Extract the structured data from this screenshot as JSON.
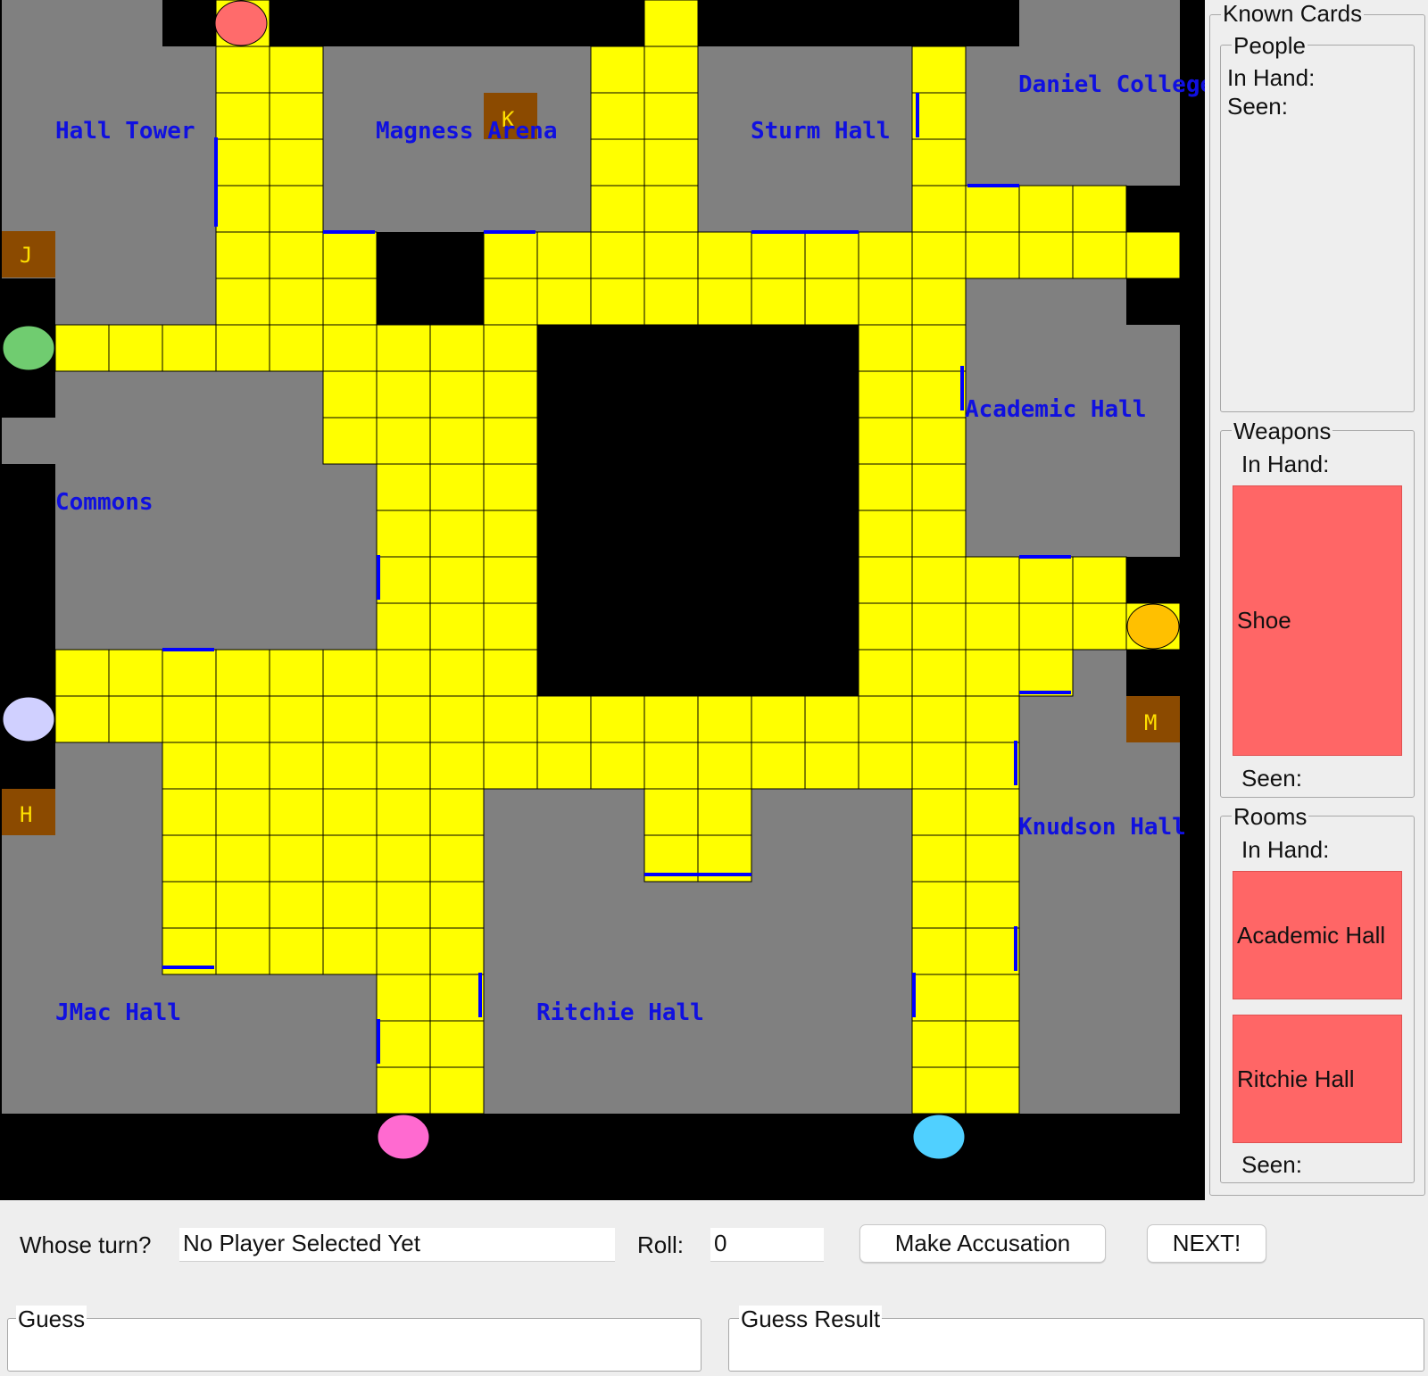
{
  "board": {
    "rooms": [
      {
        "name": "Hall Tower"
      },
      {
        "name": "Magness Arena"
      },
      {
        "name": "Sturm Hall"
      },
      {
        "name": "Daniel College"
      },
      {
        "name": "Academic Hall"
      },
      {
        "name": "Commons"
      },
      {
        "name": "Knudson Hall"
      },
      {
        "name": "JMac Hall"
      },
      {
        "name": "Ritchie Hall"
      }
    ],
    "door_markers": [
      "J",
      "K",
      "H",
      "M"
    ],
    "colors": {
      "walkway": "#ffff00",
      "room": "#808080",
      "outside": "#000000",
      "door": "#0000ff",
      "secret_passage": "#8b4a00",
      "room_label": "#1010e0"
    },
    "players": [
      {
        "color": "#ff6b6b"
      },
      {
        "color": "#70cc70"
      },
      {
        "color": "#d0d0ff"
      },
      {
        "color": "#ffc000"
      },
      {
        "color": "#ff6ad0"
      },
      {
        "color": "#50d0ff"
      }
    ]
  },
  "known_cards": {
    "title": "Known Cards",
    "people": {
      "title": "People",
      "in_hand_label": "In Hand:",
      "seen_label": "Seen:",
      "in_hand": []
    },
    "weapons": {
      "title": "Weapons",
      "in_hand_label": "In Hand:",
      "seen_label": "Seen:",
      "in_hand": [
        "Shoe"
      ]
    },
    "rooms": {
      "title": "Rooms",
      "in_hand_label": "In Hand:",
      "seen_label": "Seen:",
      "in_hand": [
        "Academic Hall",
        "Ritchie Hall"
      ]
    }
  },
  "controls": {
    "whose_turn_label": "Whose turn?",
    "whose_turn_value": "No Player Selected Yet",
    "roll_label": "Roll:",
    "roll_value": "0",
    "accuse_button": "Make Accusation",
    "next_button": "NEXT!",
    "guess_title": "Guess",
    "guess_value": "",
    "guess_result_title": "Guess Result",
    "guess_result_value": ""
  }
}
